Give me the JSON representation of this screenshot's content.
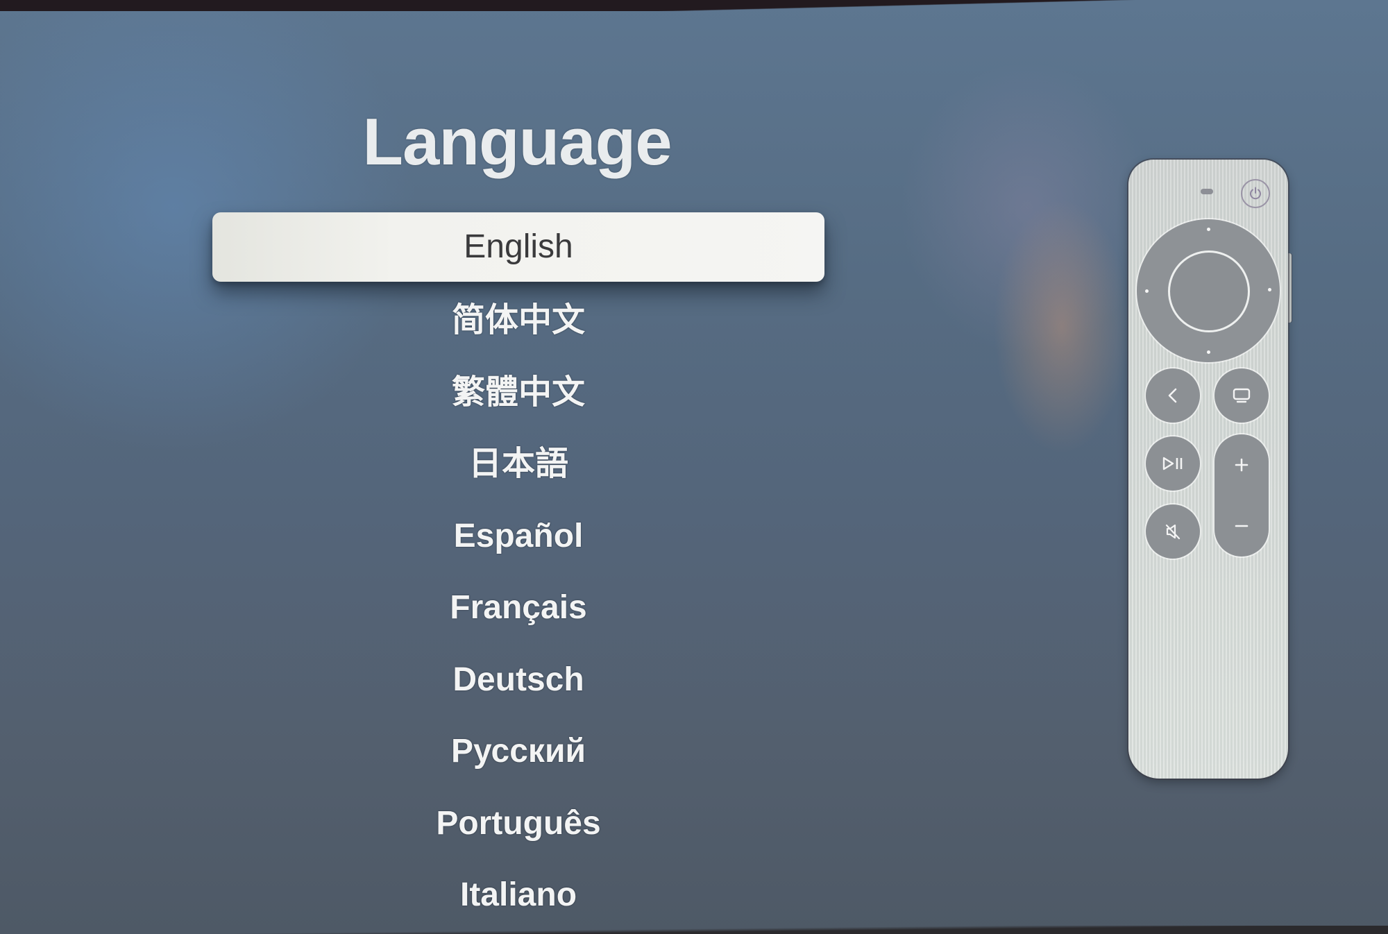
{
  "screen": {
    "title": "Language",
    "selected_index": 0,
    "languages": [
      {
        "label": "English"
      },
      {
        "label": "简体中文"
      },
      {
        "label": "繁體中文"
      },
      {
        "label": "日本語"
      },
      {
        "label": "Español"
      },
      {
        "label": "Français"
      },
      {
        "label": "Deutsch"
      },
      {
        "label": "Русский"
      },
      {
        "label": "Português"
      },
      {
        "label": "Italiano"
      }
    ]
  },
  "remote": {
    "buttons": [
      {
        "name": "power",
        "icon": "power-icon"
      },
      {
        "name": "clickpad",
        "icon": "clickpad"
      },
      {
        "name": "back",
        "icon": "chevron-left-icon"
      },
      {
        "name": "tv",
        "icon": "tv-icon"
      },
      {
        "name": "play-pause",
        "icon": "play-pause-icon"
      },
      {
        "name": "mute",
        "icon": "mute-icon"
      },
      {
        "name": "volume-up",
        "icon": "plus-icon"
      },
      {
        "name": "volume-down",
        "icon": "minus-icon"
      }
    ]
  },
  "colors": {
    "selected_bg": "#f5f5f3",
    "selected_text": "#3a3a3c",
    "text": "#f3f4f4",
    "background": "#566c83"
  }
}
